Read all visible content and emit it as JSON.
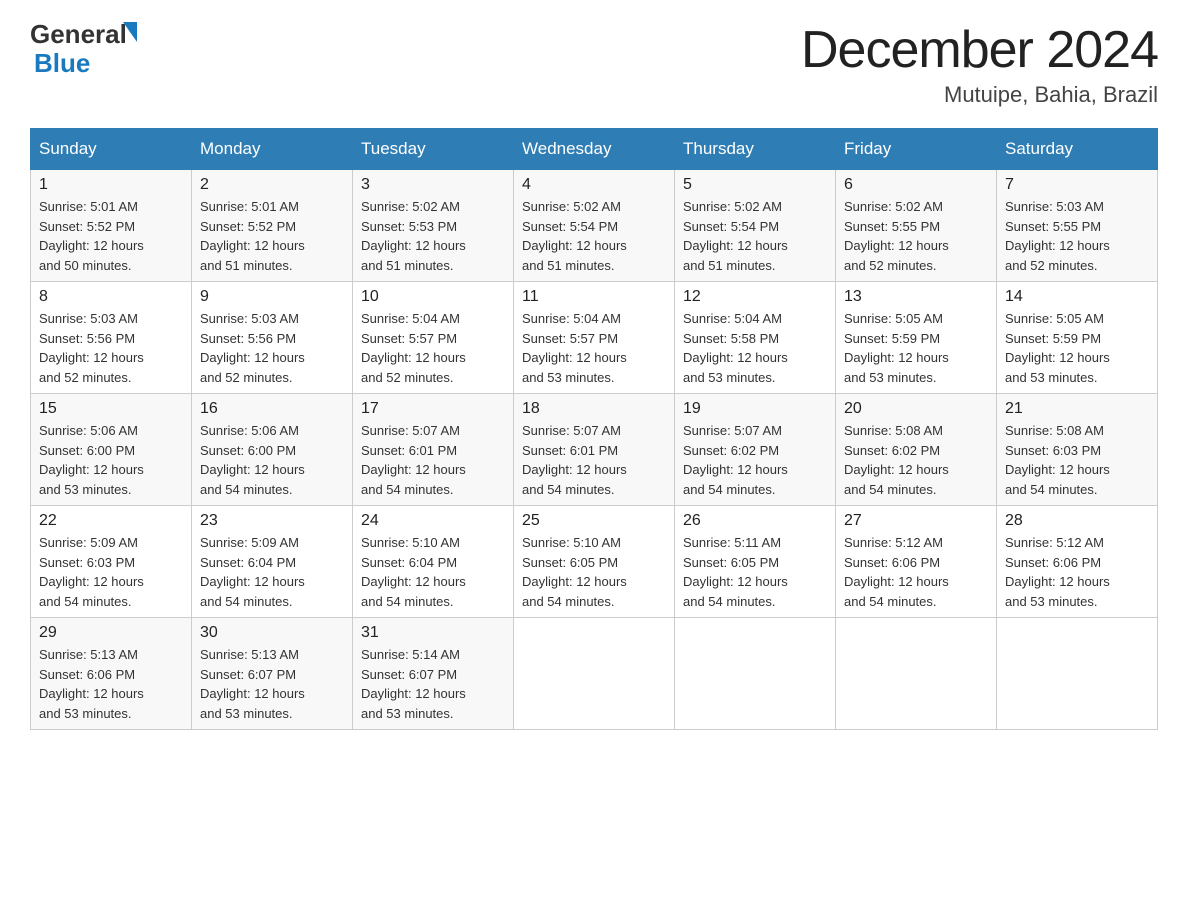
{
  "logo": {
    "text_general": "General",
    "text_blue": "Blue",
    "triangle_alt": "triangle icon"
  },
  "title": "December 2024",
  "subtitle": "Mutuipe, Bahia, Brazil",
  "days_of_week": [
    "Sunday",
    "Monday",
    "Tuesday",
    "Wednesday",
    "Thursday",
    "Friday",
    "Saturday"
  ],
  "weeks": [
    [
      {
        "day": "1",
        "sunrise": "5:01 AM",
        "sunset": "5:52 PM",
        "daylight": "12 hours and 50 minutes."
      },
      {
        "day": "2",
        "sunrise": "5:01 AM",
        "sunset": "5:52 PM",
        "daylight": "12 hours and 51 minutes."
      },
      {
        "day": "3",
        "sunrise": "5:02 AM",
        "sunset": "5:53 PM",
        "daylight": "12 hours and 51 minutes."
      },
      {
        "day": "4",
        "sunrise": "5:02 AM",
        "sunset": "5:54 PM",
        "daylight": "12 hours and 51 minutes."
      },
      {
        "day": "5",
        "sunrise": "5:02 AM",
        "sunset": "5:54 PM",
        "daylight": "12 hours and 51 minutes."
      },
      {
        "day": "6",
        "sunrise": "5:02 AM",
        "sunset": "5:55 PM",
        "daylight": "12 hours and 52 minutes."
      },
      {
        "day": "7",
        "sunrise": "5:03 AM",
        "sunset": "5:55 PM",
        "daylight": "12 hours and 52 minutes."
      }
    ],
    [
      {
        "day": "8",
        "sunrise": "5:03 AM",
        "sunset": "5:56 PM",
        "daylight": "12 hours and 52 minutes."
      },
      {
        "day": "9",
        "sunrise": "5:03 AM",
        "sunset": "5:56 PM",
        "daylight": "12 hours and 52 minutes."
      },
      {
        "day": "10",
        "sunrise": "5:04 AM",
        "sunset": "5:57 PM",
        "daylight": "12 hours and 52 minutes."
      },
      {
        "day": "11",
        "sunrise": "5:04 AM",
        "sunset": "5:57 PM",
        "daylight": "12 hours and 53 minutes."
      },
      {
        "day": "12",
        "sunrise": "5:04 AM",
        "sunset": "5:58 PM",
        "daylight": "12 hours and 53 minutes."
      },
      {
        "day": "13",
        "sunrise": "5:05 AM",
        "sunset": "5:59 PM",
        "daylight": "12 hours and 53 minutes."
      },
      {
        "day": "14",
        "sunrise": "5:05 AM",
        "sunset": "5:59 PM",
        "daylight": "12 hours and 53 minutes."
      }
    ],
    [
      {
        "day": "15",
        "sunrise": "5:06 AM",
        "sunset": "6:00 PM",
        "daylight": "12 hours and 53 minutes."
      },
      {
        "day": "16",
        "sunrise": "5:06 AM",
        "sunset": "6:00 PM",
        "daylight": "12 hours and 54 minutes."
      },
      {
        "day": "17",
        "sunrise": "5:07 AM",
        "sunset": "6:01 PM",
        "daylight": "12 hours and 54 minutes."
      },
      {
        "day": "18",
        "sunrise": "5:07 AM",
        "sunset": "6:01 PM",
        "daylight": "12 hours and 54 minutes."
      },
      {
        "day": "19",
        "sunrise": "5:07 AM",
        "sunset": "6:02 PM",
        "daylight": "12 hours and 54 minutes."
      },
      {
        "day": "20",
        "sunrise": "5:08 AM",
        "sunset": "6:02 PM",
        "daylight": "12 hours and 54 minutes."
      },
      {
        "day": "21",
        "sunrise": "5:08 AM",
        "sunset": "6:03 PM",
        "daylight": "12 hours and 54 minutes."
      }
    ],
    [
      {
        "day": "22",
        "sunrise": "5:09 AM",
        "sunset": "6:03 PM",
        "daylight": "12 hours and 54 minutes."
      },
      {
        "day": "23",
        "sunrise": "5:09 AM",
        "sunset": "6:04 PM",
        "daylight": "12 hours and 54 minutes."
      },
      {
        "day": "24",
        "sunrise": "5:10 AM",
        "sunset": "6:04 PM",
        "daylight": "12 hours and 54 minutes."
      },
      {
        "day": "25",
        "sunrise": "5:10 AM",
        "sunset": "6:05 PM",
        "daylight": "12 hours and 54 minutes."
      },
      {
        "day": "26",
        "sunrise": "5:11 AM",
        "sunset": "6:05 PM",
        "daylight": "12 hours and 54 minutes."
      },
      {
        "day": "27",
        "sunrise": "5:12 AM",
        "sunset": "6:06 PM",
        "daylight": "12 hours and 54 minutes."
      },
      {
        "day": "28",
        "sunrise": "5:12 AM",
        "sunset": "6:06 PM",
        "daylight": "12 hours and 53 minutes."
      }
    ],
    [
      {
        "day": "29",
        "sunrise": "5:13 AM",
        "sunset": "6:06 PM",
        "daylight": "12 hours and 53 minutes."
      },
      {
        "day": "30",
        "sunrise": "5:13 AM",
        "sunset": "6:07 PM",
        "daylight": "12 hours and 53 minutes."
      },
      {
        "day": "31",
        "sunrise": "5:14 AM",
        "sunset": "6:07 PM",
        "daylight": "12 hours and 53 minutes."
      },
      null,
      null,
      null,
      null
    ]
  ],
  "labels": {
    "sunrise": "Sunrise:",
    "sunset": "Sunset:",
    "daylight": "Daylight:"
  }
}
